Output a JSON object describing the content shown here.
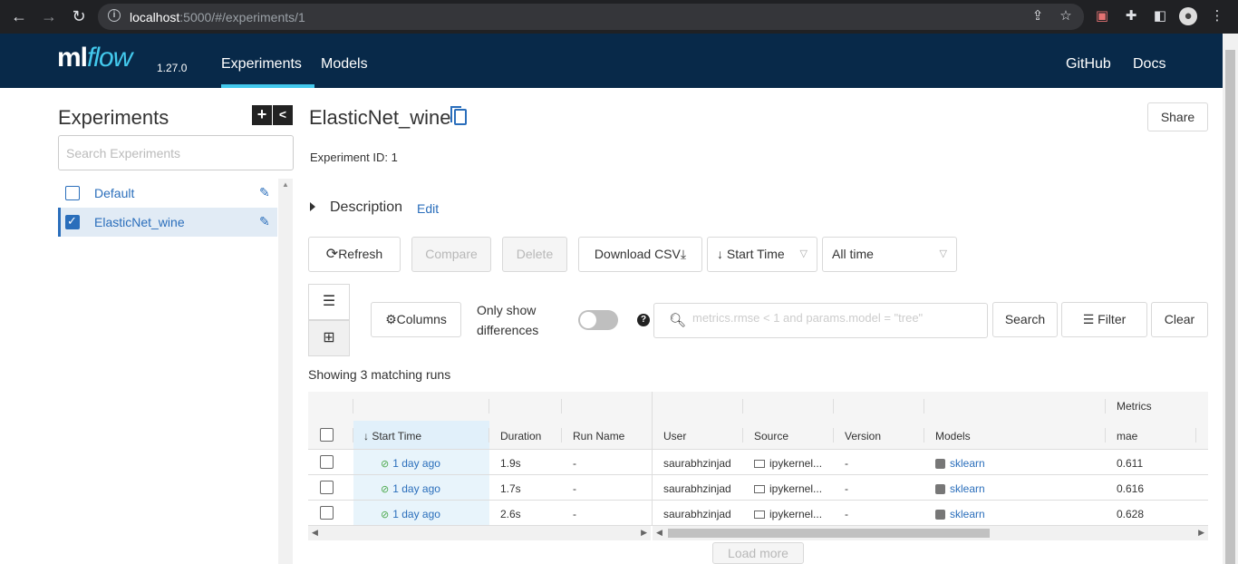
{
  "browser": {
    "url_host": "localhost",
    "url_path": ":5000/#/experiments/1"
  },
  "header": {
    "logo_ml": "ml",
    "logo_flow": "flow",
    "version": "1.27.0",
    "nav": [
      "Experiments",
      "Models"
    ],
    "right_links": [
      "GitHub",
      "Docs"
    ]
  },
  "sidebar": {
    "title": "Experiments",
    "search_placeholder": "Search Experiments",
    "items": [
      {
        "label": "Default",
        "checked": false
      },
      {
        "label": "ElasticNet_wine",
        "checked": true
      }
    ]
  },
  "experiment": {
    "name": "ElasticNet_wine",
    "id_label": "Experiment ID:",
    "id_value": "1",
    "share": "Share",
    "description_label": "Description",
    "description_edit": "Edit"
  },
  "toolbar": {
    "refresh": "Refresh",
    "compare": "Compare",
    "delete": "Delete",
    "download_csv": "Download CSV",
    "sort_by": "Start Time",
    "time_range": "All time",
    "columns": "Columns",
    "only_show_line1": "Only show",
    "only_show_line2": "differences",
    "search_placeholder": "metrics.rmse < 1 and params.model = \"tree\"",
    "search": "Search",
    "filter": "Filter",
    "clear": "Clear"
  },
  "runs": {
    "showing": "Showing 3 matching runs",
    "group_header": "Metrics",
    "columns": [
      "Start Time",
      "Duration",
      "Run Name",
      "User",
      "Source",
      "Version",
      "Models",
      "mae"
    ],
    "rows": [
      {
        "start_time": "1 day ago",
        "duration": "1.9s",
        "run_name": "-",
        "user": "saurabhzinjad",
        "source": "ipykernel...",
        "version": "-",
        "model": "sklearn",
        "mae": "0.611"
      },
      {
        "start_time": "1 day ago",
        "duration": "1.7s",
        "run_name": "-",
        "user": "saurabhzinjad",
        "source": "ipykernel...",
        "version": "-",
        "model": "sklearn",
        "mae": "0.616"
      },
      {
        "start_time": "1 day ago",
        "duration": "2.6s",
        "run_name": "-",
        "user": "saurabhzinjad",
        "source": "ipykernel...",
        "version": "-",
        "model": "sklearn",
        "mae": "0.628"
      }
    ],
    "load_more": "Load more"
  }
}
